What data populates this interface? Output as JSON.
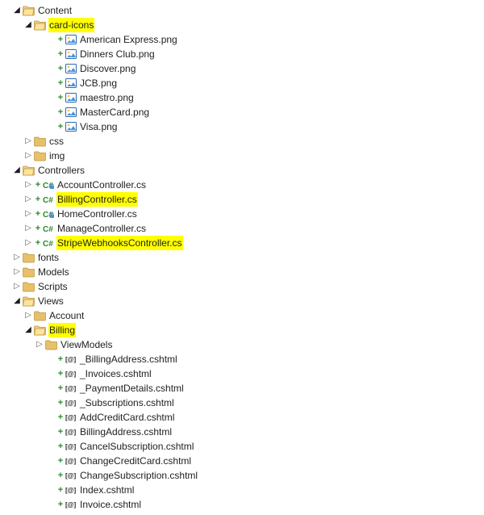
{
  "tree": {
    "content": {
      "label": "Content"
    },
    "cardIcons": {
      "label": "card-icons"
    },
    "files_cardIcons": [
      "American Express.png",
      "Dinners Club.png",
      "Discover.png",
      "JCB.png",
      "maestro.png",
      "MasterCard.png",
      "Visa.png"
    ],
    "css": {
      "label": "css"
    },
    "img": {
      "label": "img"
    },
    "controllers": {
      "label": "Controllers"
    },
    "controllers_files": {
      "account": "AccountController.cs",
      "billing": "BillingController.cs",
      "home": "HomeController.cs",
      "manage": "ManageController.cs",
      "stripe": "StripeWebhooksController.cs"
    },
    "fonts": {
      "label": "fonts"
    },
    "models": {
      "label": "Models"
    },
    "scripts": {
      "label": "Scripts"
    },
    "views": {
      "label": "Views"
    },
    "views_account": {
      "label": "Account"
    },
    "views_billing": {
      "label": "Billing"
    },
    "views_billing_vm": {
      "label": "ViewModels"
    },
    "views_billing_files": [
      "_BillingAddress.cshtml",
      "_Invoices.cshtml",
      "_PaymentDetails.cshtml",
      "_Subscriptions.cshtml",
      "AddCreditCard.cshtml",
      "BillingAddress.cshtml",
      "CancelSubscription.cshtml",
      "ChangeCreditCard.cshtml",
      "ChangeSubscription.cshtml",
      "Index.cshtml",
      "Invoice.cshtml"
    ]
  }
}
